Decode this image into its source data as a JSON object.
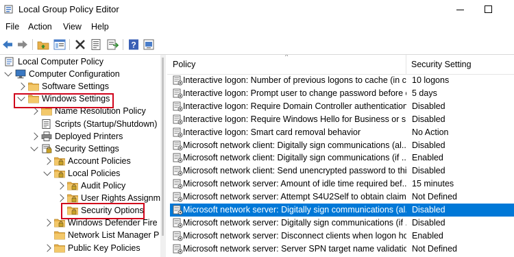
{
  "window": {
    "title": "Local Group Policy Editor"
  },
  "menu": [
    "File",
    "Action",
    "View",
    "Help"
  ],
  "toolbar": {
    "icons": [
      "back-icon",
      "forward-icon",
      "up-folder-icon",
      "show-hide-tree-icon",
      "delete-icon",
      "properties-icon",
      "export-list-icon",
      "help-icon",
      "help-topics-icon"
    ]
  },
  "tree": [
    {
      "label": "Local Computer Policy",
      "level": 0,
      "icon": "computer-policy-icon",
      "arrow": "none"
    },
    {
      "label": "Computer Configuration",
      "level": 1,
      "icon": "computer-icon",
      "arrow": "down"
    },
    {
      "label": "Software Settings",
      "level": 2,
      "icon": "folder-icon",
      "arrow": "right"
    },
    {
      "label": "Windows Settings",
      "level": 2,
      "icon": "folder-icon",
      "arrow": "down",
      "highlighted": true
    },
    {
      "label": "Name Resolution Policy",
      "level": 3,
      "icon": "folder-icon",
      "arrow": "right"
    },
    {
      "label": "Scripts (Startup/Shutdown)",
      "level": 3,
      "icon": "scripts-icon",
      "arrow": "none"
    },
    {
      "label": "Deployed Printers",
      "level": 3,
      "icon": "printer-icon",
      "arrow": "right"
    },
    {
      "label": "Security Settings",
      "level": 3,
      "icon": "security-settings-icon",
      "arrow": "down"
    },
    {
      "label": "Account Policies",
      "level": 4,
      "icon": "locked-folder-icon",
      "arrow": "right"
    },
    {
      "label": "Local Policies",
      "level": 4,
      "icon": "locked-folder-icon",
      "arrow": "down"
    },
    {
      "label": "Audit Policy",
      "level": 5,
      "icon": "locked-folder-icon",
      "arrow": "right"
    },
    {
      "label": "User Rights Assignm",
      "level": 5,
      "icon": "locked-folder-icon",
      "arrow": "right"
    },
    {
      "label": "Security Options",
      "level": 5,
      "icon": "locked-folder-icon",
      "arrow": "none",
      "highlighted": true
    },
    {
      "label": "Windows Defender Fire",
      "level": 4,
      "icon": "locked-folder-icon",
      "arrow": "right"
    },
    {
      "label": "Network List Manager P",
      "level": 4,
      "icon": "folder-icon",
      "arrow": "none"
    },
    {
      "label": "Public Key Policies",
      "level": 4,
      "icon": "folder-icon",
      "arrow": "right"
    }
  ],
  "list": {
    "columns": [
      "Policy",
      "Security Setting"
    ],
    "rows": [
      {
        "policy": "Interactive logon: Number of previous logons to cache (in c...",
        "setting": "10 logons"
      },
      {
        "policy": "Interactive logon: Prompt user to change password before e...",
        "setting": "5 days"
      },
      {
        "policy": "Interactive logon: Require Domain Controller authentication...",
        "setting": "Disabled"
      },
      {
        "policy": "Interactive logon: Require Windows Hello for Business or sm...",
        "setting": "Disabled"
      },
      {
        "policy": "Interactive logon: Smart card removal behavior",
        "setting": "No Action"
      },
      {
        "policy": "Microsoft network client: Digitally sign communications (al...",
        "setting": "Disabled"
      },
      {
        "policy": "Microsoft network client: Digitally sign communications (if ...",
        "setting": "Enabled"
      },
      {
        "policy": "Microsoft network client: Send unencrypted password to thi...",
        "setting": "Disabled"
      },
      {
        "policy": "Microsoft network server: Amount of idle time required bef...",
        "setting": "15 minutes"
      },
      {
        "policy": "Microsoft network server: Attempt S4U2Self to obtain claim ...",
        "setting": "Not Defined"
      },
      {
        "policy": "Microsoft network server: Digitally sign communications (al...",
        "setting": "Disabled",
        "selected": true
      },
      {
        "policy": "Microsoft network server: Digitally sign communications (if ...",
        "setting": "Disabled"
      },
      {
        "policy": "Microsoft network server: Disconnect clients when logon ho...",
        "setting": "Enabled"
      },
      {
        "policy": "Microsoft network server: Server SPN target name validation...",
        "setting": "Not Defined"
      }
    ]
  },
  "colors": {
    "selection": "#0078d7",
    "highlight_box": "#d0021b",
    "folder": "#e8b04a"
  }
}
